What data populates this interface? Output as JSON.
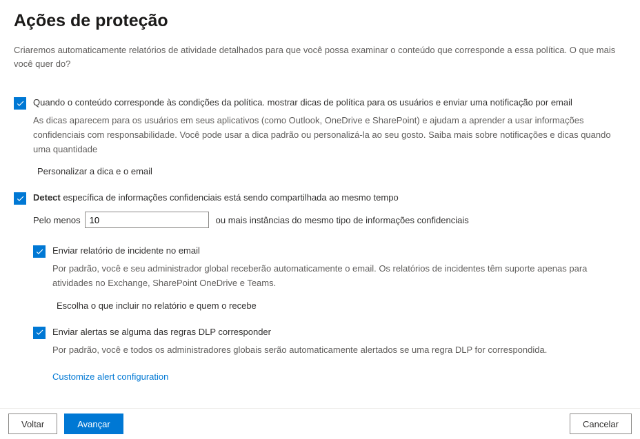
{
  "title": "Ações de proteção",
  "description": "Criaremos automaticamente relatórios de atividade detalhados para que você possa examinar o conteúdo que corresponde a essa política. O que mais você quer do?",
  "option1": {
    "label": "Quando o conteúdo corresponde às condições da política. mostrar dicas de política para os usuários e enviar uma notificação por email",
    "desc": "As dicas aparecem para os usuários em seus aplicativos (como Outlook, OneDrive e SharePoint) e ajudam a aprender a usar informações confidenciais com responsabilidade. Você pode usar a dica padrão ou personalizá-la ao seu gosto. Saiba mais sobre notificações e dicas quando uma quantidade",
    "link": "Personalizar a dica e o email"
  },
  "option2": {
    "bold": "Detect",
    "rest": " específica de informações confidenciais está sendo compartilhada ao mesmo tempo",
    "atleast_prefix": "Pelo menos",
    "atleast_value": "10",
    "atleast_suffix": "ou mais instâncias do mesmo tipo de informações confidenciais"
  },
  "option3": {
    "label": "Enviar relatório de incidente no email",
    "desc": "Por padrão, você e seu administrador global receberão automaticamente o email. Os relatórios de incidentes têm suporte apenas para atividades no Exchange, SharePoint OneDrive e Teams.",
    "link": "Escolha o que incluir no relatório e quem o recebe"
  },
  "option4": {
    "label": "Enviar alertas se alguma das regras DLP corresponder",
    "desc": "Por padrão, você e todos os administradores globais serão automaticamente alertados se uma regra DLP for correspondida.",
    "cut_link": "Customize alert configuration"
  },
  "footer": {
    "back": "Voltar",
    "next": "Avançar",
    "cancel": "Cancelar"
  }
}
